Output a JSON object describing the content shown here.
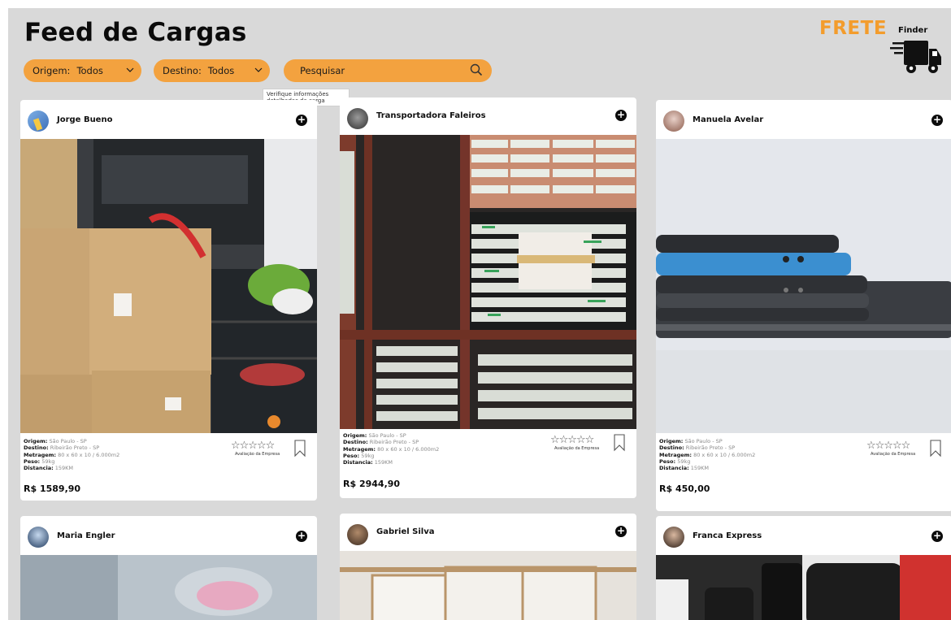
{
  "header": {
    "title": "Feed de Cargas",
    "logo_main": "FRETE",
    "logo_sub": "Finder"
  },
  "filters": {
    "origem_label": "Origem:",
    "origem_value": "Todos",
    "destino_label": "Destino:",
    "destino_value": "Todos",
    "search_placeholder": "Pesquisar",
    "tooltip": "Verifique informações detalhadas da carga"
  },
  "labels": {
    "origem": "Origem:",
    "destino": "Destino:",
    "metragem": "Metragem:",
    "peso": "Peso:",
    "distancia": "Distancia:",
    "rating": "Avaliação da Empresa",
    "stars": "☆☆☆☆☆"
  },
  "cards": [
    {
      "name": "Jorge Bueno",
      "origem": "São Paulo - SP",
      "destino": "Ribeirão Preto - SP",
      "metragem": "80 x 60 x 10 / 6.000m2",
      "peso": "59kg",
      "distancia": "159KM",
      "price": "R$ 1589,90"
    },
    {
      "name": "Transportadora Faleiros",
      "origem": "São Paulo - SP",
      "destino": "Ribeirão Preto - SP",
      "metragem": "80 x 60 x 10 / 6.000m2",
      "peso": "59kg",
      "distancia": "159KM",
      "price": "R$ 2944,90"
    },
    {
      "name": "Manuela Avelar",
      "origem": "São Paulo - SP",
      "destino": "Ribeirão Preto - SP",
      "metragem": "80 x 60 x 10 / 6.000m2",
      "peso": "59kg",
      "distancia": "159KM",
      "price": "R$ 450,00"
    },
    {
      "name": "Maria Engler"
    },
    {
      "name": "Gabriel Silva"
    },
    {
      "name": "Franca Express"
    }
  ],
  "colors": {
    "accent": "#f3a23f",
    "background": "#d9d9d9",
    "card": "#ffffff",
    "logo_orange": "#f39c2c"
  }
}
